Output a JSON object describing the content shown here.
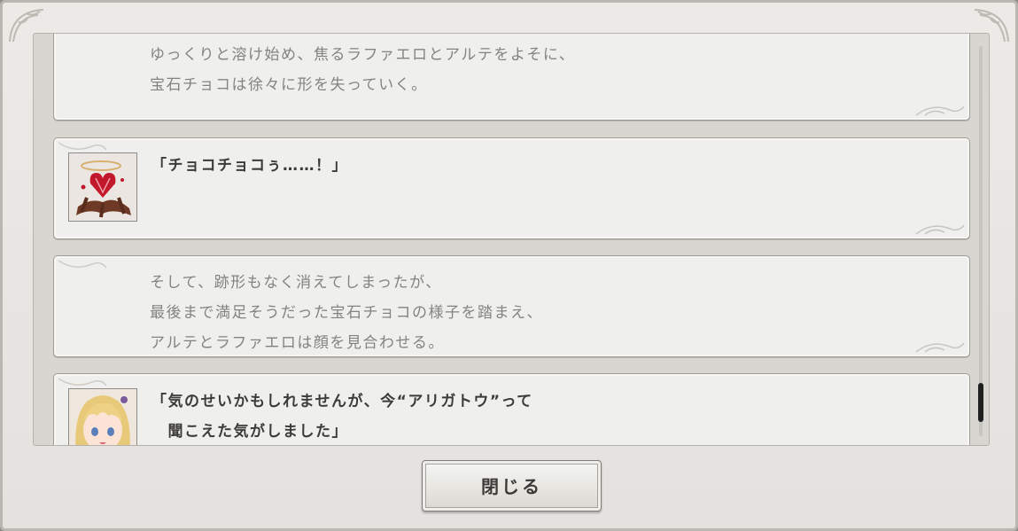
{
  "log_entries": [
    {
      "type": "narration",
      "lines": [
        "ゆっくりと溶け始め、焦るラファエロとアルテをよそに、",
        "宝石チョコは徐々に形を失っていく。"
      ]
    },
    {
      "type": "dialogue",
      "portrait": "jewel-chocolate-heart-portrait",
      "lines": [
        "「チョコチョコぅ……！」"
      ]
    },
    {
      "type": "narration",
      "lines": [
        "そして、跡形もなく消えてしまったが、",
        "最後まで満足そうだった宝石チョコの様子を踏まえ、",
        "アルテとラファエロは顔を見合わせる。"
      ]
    },
    {
      "type": "dialogue",
      "portrait": "blonde-girl-portrait",
      "lines": [
        "「気のせいかもしれませんが、今“アリガトウ”って",
        "　聞こえた気がしました」"
      ]
    }
  ],
  "close_button": {
    "label": "閉じる"
  },
  "scroll": {
    "position": 0.92
  },
  "colors": {
    "frame": "#e9e7e3",
    "entry_bg": "#efefed",
    "narration_text": "#85837e",
    "dialogue_text": "#3c3b38"
  }
}
